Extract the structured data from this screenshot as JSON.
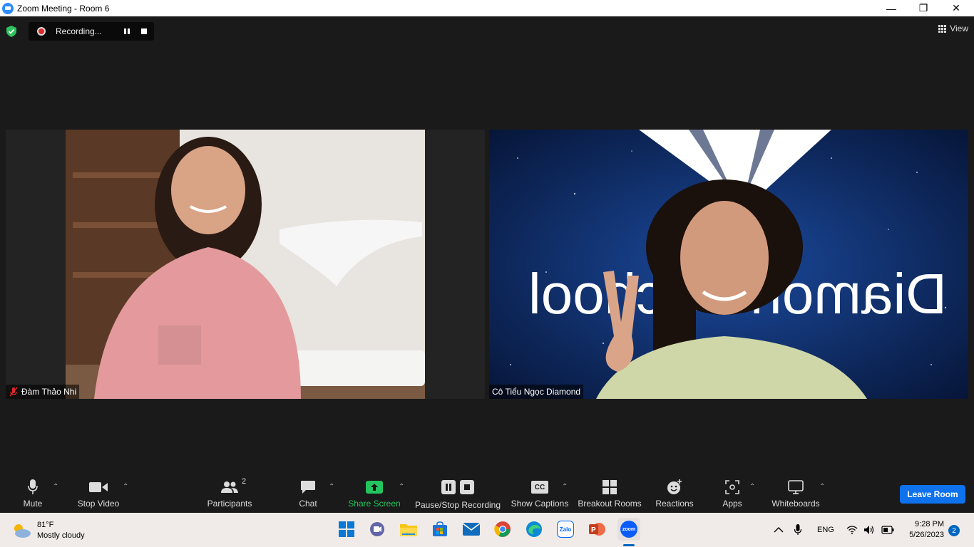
{
  "window": {
    "title": "Zoom Meeting - Room 6",
    "minimize": "—",
    "maximize": "❐",
    "close": "✕"
  },
  "meeting": {
    "recording_label": "Recording...",
    "view_label": "View"
  },
  "participants": [
    {
      "name": "Đàm Thảo Nhi",
      "muted": true
    },
    {
      "name": "Cô Tiểu Ngọc Diamond",
      "muted": false
    }
  ],
  "background_text": "Diamond School",
  "toolbar": {
    "mute": "Mute",
    "stop_video": "Stop Video",
    "participants": "Participants",
    "participants_count": "2",
    "chat": "Chat",
    "share_screen": "Share Screen",
    "pause_stop_recording": "Pause/Stop Recording",
    "show_captions": "Show Captions",
    "captions_icon_text": "CC",
    "breakout_rooms": "Breakout Rooms",
    "reactions": "Reactions",
    "apps": "Apps",
    "whiteboards": "Whiteboards",
    "leave_room": "Leave Room"
  },
  "colors": {
    "meeting_bg": "#1a1a1a",
    "share_green": "#22c55e",
    "leave_blue": "#0e72ed",
    "taskbar_bg": "#f0ebe9"
  },
  "taskbar": {
    "weather_temp": "81°F",
    "weather_desc": "Mostly cloudy",
    "apps": [
      "windows-start",
      "teams-chat",
      "file-explorer",
      "microsoft-store",
      "mail",
      "chrome",
      "edge",
      "zalo",
      "powerpoint",
      "zoom"
    ],
    "zalo_label": "Zalo",
    "zoom_label": "zoom",
    "language": "ENG",
    "time": "9:28 PM",
    "date": "5/26/2023",
    "notifications": "2"
  }
}
